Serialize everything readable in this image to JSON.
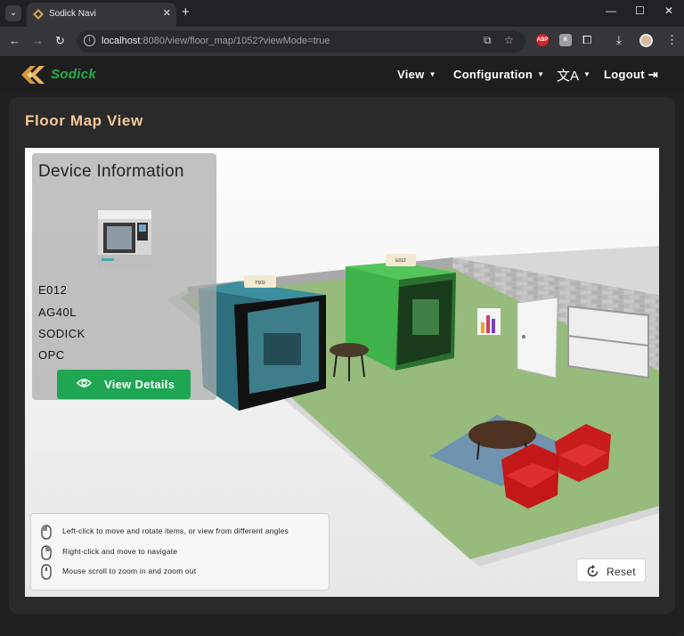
{
  "browser": {
    "tab_title": "Sodick Navi",
    "url_host": "localhost",
    "url_rest": ":8080/view/floor_map/1052?viewMode=true",
    "extensions": [
      "ABP",
      "K"
    ]
  },
  "navbar": {
    "logo_text": "Sodick",
    "menu": [
      {
        "label": "View"
      },
      {
        "label": "Configuration"
      }
    ],
    "language_icon": "translate-icon",
    "logout_label": "Logout"
  },
  "page": {
    "title": "Floor Map View"
  },
  "scene": {
    "machine_labels": [
      "T503",
      "E012"
    ]
  },
  "device_info": {
    "title": "Device Information",
    "id": "E012",
    "model": "AG40L",
    "maker": "SODICK",
    "protocol": "OPC",
    "button_label": "View Details"
  },
  "help": {
    "items": [
      {
        "icon": "mouse-left-click-icon",
        "text": "Left-click to move and rotate items, or view from different angles"
      },
      {
        "icon": "mouse-right-click-icon",
        "text": "Right-click and move to navigate"
      },
      {
        "icon": "mouse-scroll-icon",
        "text": "Mouse scroll to zoom in and zoom out"
      }
    ]
  },
  "reset": {
    "label": "Reset"
  },
  "colors": {
    "brand_green": "#24b04a",
    "title_accent": "#f3c99a",
    "button_green": "#1fa653",
    "floor": "#97bb7c"
  }
}
